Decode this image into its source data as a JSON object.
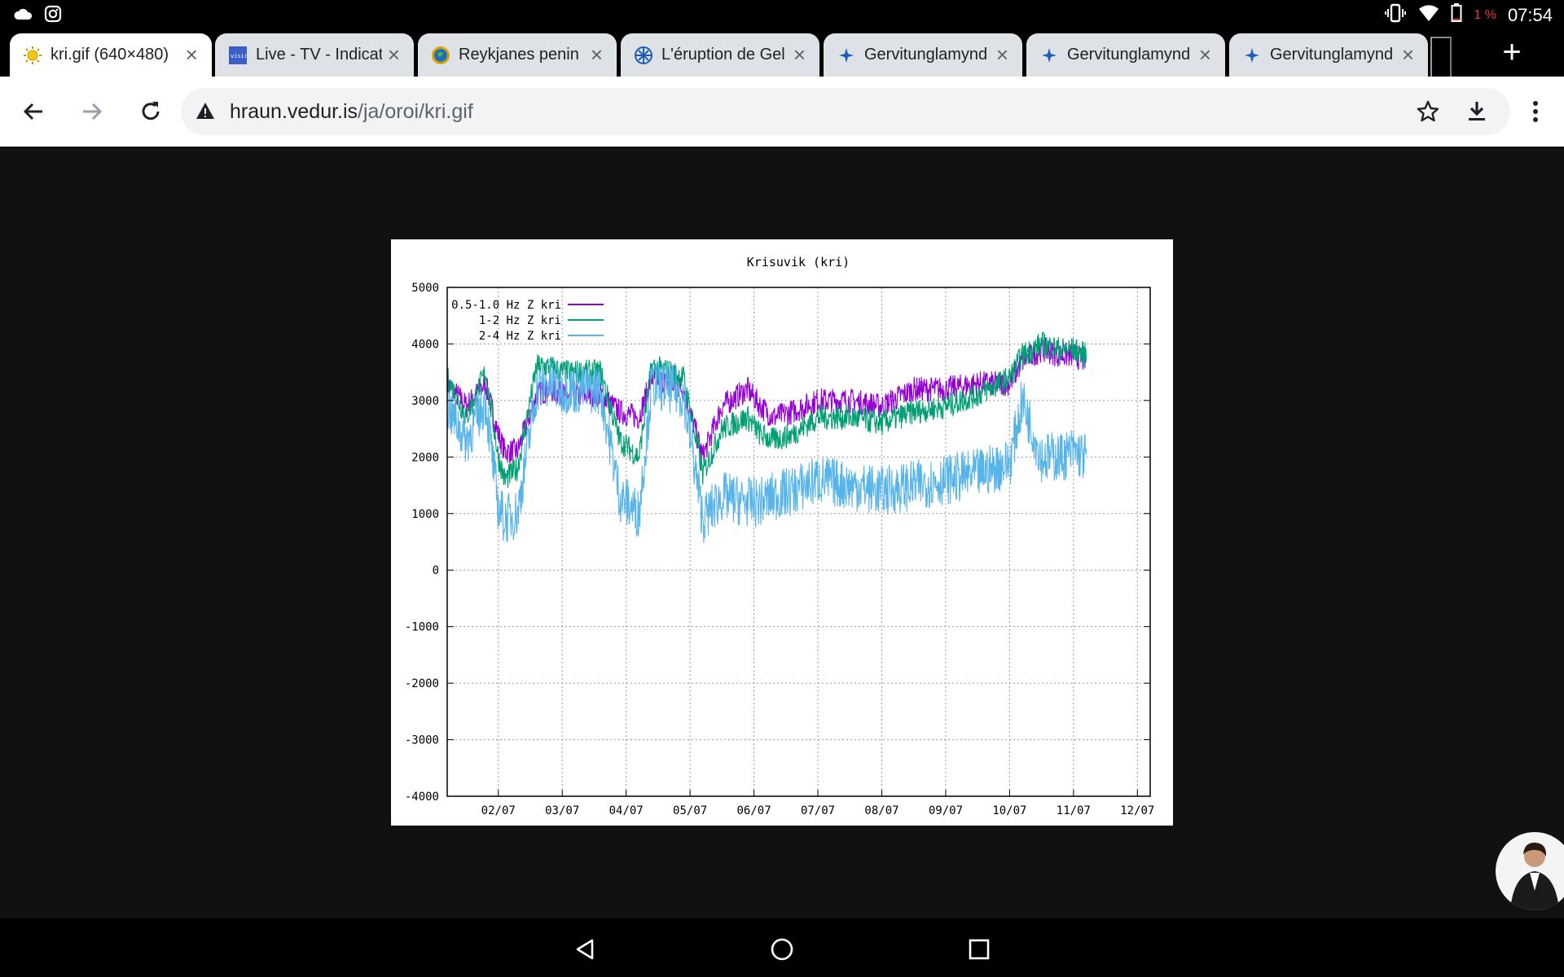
{
  "status_bar": {
    "notification_icons": [
      "cloud-icon",
      "instagram-icon"
    ],
    "system_icons": [
      "vibrate-icon",
      "wifi-icon",
      "battery-icon"
    ],
    "battery_percent": "1 %",
    "time": "07:54"
  },
  "tabs": [
    {
      "title": "kri.gif (640×480)",
      "active": true,
      "favicon": "sun-icon"
    },
    {
      "title": "Live - TV - Indicat",
      "active": false,
      "favicon": "visir-icon"
    },
    {
      "title": "Reykjanes penin",
      "active": false,
      "favicon": "globe-icon"
    },
    {
      "title": "L'éruption de Gel",
      "active": false,
      "favicon": "snowflake-icon"
    },
    {
      "title": "Gervitunglamynd",
      "active": false,
      "favicon": "satellite-icon"
    },
    {
      "title": "Gervitunglamynd",
      "active": false,
      "favicon": "satellite-icon"
    },
    {
      "title": "Gervitunglamynd",
      "active": false,
      "favicon": "satellite-icon"
    }
  ],
  "new_tab_label": "+",
  "toolbar": {
    "url_host": "hraun.vedur.is",
    "url_path": "/ja/oroi/kri.gif",
    "security_icon": "not-secure-warning-icon"
  },
  "chart_data": {
    "type": "line",
    "title": "Krisuvik (kri)",
    "xlabel": "",
    "ylabel": "",
    "ylim": [
      -4000,
      5000
    ],
    "yticks": [
      5000,
      4000,
      3000,
      2000,
      1000,
      0,
      -1000,
      -2000,
      -3000,
      -4000
    ],
    "xticks": [
      "02/07",
      "03/07",
      "04/07",
      "05/07",
      "06/07",
      "07/07",
      "08/07",
      "09/07",
      "10/07",
      "11/07",
      "12/07"
    ],
    "xlim_days": [
      1.2,
      12.2
    ],
    "grid": true,
    "legend_position": "top-left",
    "x": [
      1.2,
      1.5,
      1.8,
      2.0,
      2.1,
      2.3,
      2.6,
      2.8,
      3.0,
      3.3,
      3.6,
      3.9,
      4.2,
      4.4,
      4.7,
      4.9,
      5.2,
      5.5,
      5.9,
      6.1,
      6.3,
      6.6,
      7.0,
      7.5,
      8.0,
      8.5,
      9.0,
      9.5,
      10.0,
      10.2,
      10.5,
      10.8,
      11.0,
      11.2
    ],
    "series": [
      {
        "name": "0.5-1.0 Hz Z kri",
        "color": "#9400d3",
        "values": [
          3300,
          2900,
          3300,
          2400,
          2100,
          2100,
          3100,
          3200,
          3100,
          3100,
          3100,
          2800,
          2700,
          3400,
          3300,
          3200,
          2000,
          2900,
          3200,
          2900,
          2700,
          2800,
          3000,
          3000,
          2900,
          3200,
          3200,
          3300,
          3300,
          3700,
          3900,
          3800,
          3800,
          3700
        ]
      },
      {
        "name": "1-2 Hz Z kri",
        "color": "#009e73",
        "values": [
          3400,
          2700,
          3500,
          2000,
          1600,
          1800,
          3600,
          3600,
          3500,
          3500,
          3500,
          2300,
          2000,
          3600,
          3500,
          3400,
          1700,
          2500,
          2700,
          2400,
          2300,
          2400,
          2700,
          2700,
          2600,
          2800,
          2900,
          3100,
          3400,
          3800,
          4000,
          3900,
          3900,
          3800
        ]
      },
      {
        "name": "2-4 Hz Z kri",
        "color": "#56b4e9",
        "values": [
          2900,
          2300,
          3000,
          1100,
          900,
          1000,
          3200,
          3300,
          3200,
          3200,
          3200,
          1300,
          1000,
          3300,
          3200,
          3100,
          900,
          1300,
          1200,
          1200,
          1300,
          1400,
          1600,
          1500,
          1400,
          1500,
          1600,
          1700,
          1900,
          3000,
          2000,
          2000,
          2100,
          2000
        ]
      }
    ]
  },
  "navigation_bar": {
    "buttons": [
      "back-triangle-icon",
      "home-circle-icon",
      "recents-square-icon"
    ]
  }
}
